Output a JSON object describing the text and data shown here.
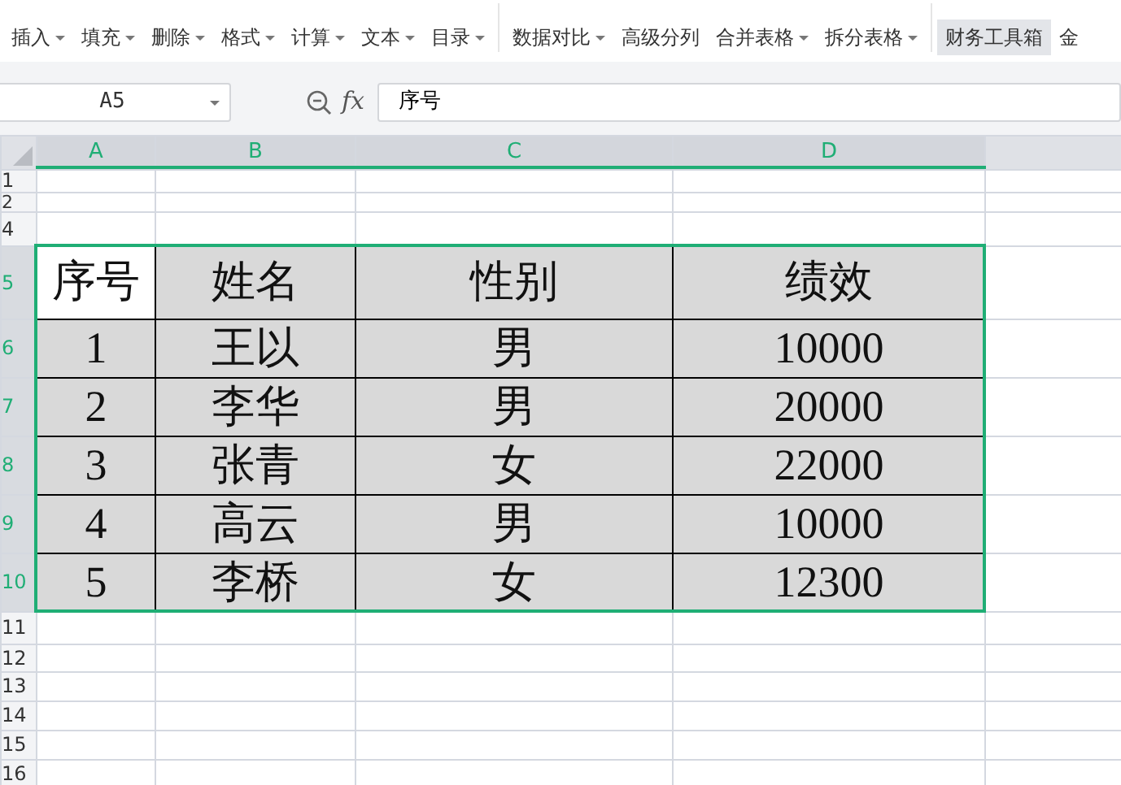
{
  "toolbar": [
    {
      "label": "插入",
      "dropdown": true,
      "selected": false
    },
    {
      "label": "填充",
      "dropdown": true,
      "selected": false
    },
    {
      "label": "删除",
      "dropdown": true,
      "selected": false
    },
    {
      "label": "格式",
      "dropdown": true,
      "selected": false
    },
    {
      "label": "计算",
      "dropdown": true,
      "selected": false
    },
    {
      "label": "文本",
      "dropdown": true,
      "selected": false
    },
    {
      "label": "目录",
      "dropdown": true,
      "selected": false
    },
    {
      "kind": "divider"
    },
    {
      "label": "数据对比",
      "dropdown": true,
      "selected": false
    },
    {
      "label": "高级分列",
      "dropdown": false,
      "selected": false
    },
    {
      "label": "合并表格",
      "dropdown": true,
      "selected": false
    },
    {
      "label": "拆分表格",
      "dropdown": true,
      "selected": false
    },
    {
      "kind": "divider"
    },
    {
      "label": "财务工具箱",
      "dropdown": false,
      "selected": true
    },
    {
      "label": "金",
      "dropdown": false,
      "selected": false
    }
  ],
  "name_box": "A5",
  "function_label": "fx",
  "formula": "序号",
  "columns": [
    {
      "label": "A",
      "selected": true
    },
    {
      "label": "B",
      "selected": true
    },
    {
      "label": "C",
      "selected": true
    },
    {
      "label": "D",
      "selected": true
    }
  ],
  "rows": [
    {
      "header": "1",
      "selected": false,
      "cells": []
    },
    {
      "header": "2",
      "selected": false,
      "cells": []
    },
    {
      "header": "4",
      "selected": false,
      "cells": []
    },
    {
      "header": "5",
      "selected": true,
      "cells": [
        {
          "text": "序号",
          "active": true
        },
        {
          "text": "姓名",
          "active": false
        },
        {
          "text": "性别",
          "active": false
        },
        {
          "text": "绩效",
          "active": false
        }
      ]
    },
    {
      "header": "6",
      "selected": true,
      "cells": [
        {
          "text": "1",
          "active": false
        },
        {
          "text": "王以",
          "active": false
        },
        {
          "text": "男",
          "active": false
        },
        {
          "text": "10000",
          "active": false
        }
      ]
    },
    {
      "header": "7",
      "selected": true,
      "cells": [
        {
          "text": "2",
          "active": false
        },
        {
          "text": "李华",
          "active": false
        },
        {
          "text": "男",
          "active": false
        },
        {
          "text": "20000",
          "active": false
        }
      ]
    },
    {
      "header": "8",
      "selected": true,
      "cells": [
        {
          "text": "3",
          "active": false
        },
        {
          "text": "张青",
          "active": false
        },
        {
          "text": "女",
          "active": false
        },
        {
          "text": "22000",
          "active": false
        }
      ]
    },
    {
      "header": "9",
      "selected": true,
      "cells": [
        {
          "text": "4",
          "active": false
        },
        {
          "text": "高云",
          "active": false
        },
        {
          "text": "男",
          "active": false
        },
        {
          "text": "10000",
          "active": false
        }
      ]
    },
    {
      "header": "10",
      "selected": true,
      "cells": [
        {
          "text": "5",
          "active": false
        },
        {
          "text": "李桥",
          "active": false
        },
        {
          "text": "女",
          "active": false
        },
        {
          "text": "12300",
          "active": false
        }
      ]
    },
    {
      "header": "11",
      "selected": false,
      "cells": []
    },
    {
      "header": "12",
      "selected": false,
      "cells": []
    },
    {
      "header": "13",
      "selected": false,
      "cells": []
    },
    {
      "header": "14",
      "selected": false,
      "cells": []
    },
    {
      "header": "15",
      "selected": false,
      "cells": []
    },
    {
      "header": "16",
      "selected": false,
      "cells": []
    }
  ]
}
